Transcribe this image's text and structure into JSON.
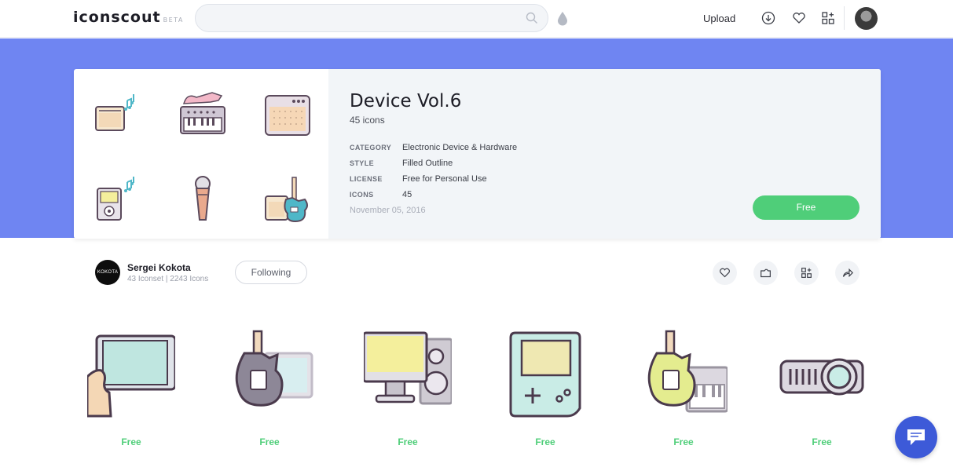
{
  "header": {
    "logo_text": "iconscout",
    "logo_badge": "BETA",
    "search_placeholder": "",
    "upload_label": "Upload",
    "icons": [
      "search-icon",
      "drop-icon",
      "download-icon",
      "heart-icon",
      "collections-icon",
      "avatar"
    ]
  },
  "iconset": {
    "title": "Device Vol.6",
    "count_text": "45 icons",
    "meta": [
      {
        "key": "CATEGORY",
        "value": "Electronic Device & Hardware"
      },
      {
        "key": "STYLE",
        "value": "Filled Outline"
      },
      {
        "key": "LICENSE",
        "value": "Free for Personal Use"
      },
      {
        "key": "ICONS",
        "value": "45"
      }
    ],
    "date": "November 05, 2016",
    "free_button": "Free",
    "preview_icons": [
      "amplifier-music-icon",
      "synthesizer-guitar-icon",
      "speaker-amp-icon",
      "music-player-icon",
      "microphone-icon",
      "guitar-amp-icon"
    ]
  },
  "author": {
    "avatar_text": "KOKOTA",
    "name": "Sergei Kokota",
    "stats": "43 Iconset | 2243 Icons",
    "follow_label": "Following",
    "actions": [
      "heart-icon",
      "folder-icon",
      "collections-icon",
      "share-icon"
    ]
  },
  "icons": [
    {
      "name": "tablet-hand-icon",
      "label": "Free"
    },
    {
      "name": "guitar-monitor-icon",
      "label": "Free"
    },
    {
      "name": "desktop-speaker-icon",
      "label": "Free"
    },
    {
      "name": "gameboy-icon",
      "label": "Free"
    },
    {
      "name": "guitar-keyboard-icon",
      "label": "Free"
    },
    {
      "name": "projector-icon",
      "label": "Free"
    }
  ],
  "colors": {
    "accent_band": "#6f85f2",
    "free_green": "#4fce79",
    "chat_blue": "#3d5ad8"
  }
}
